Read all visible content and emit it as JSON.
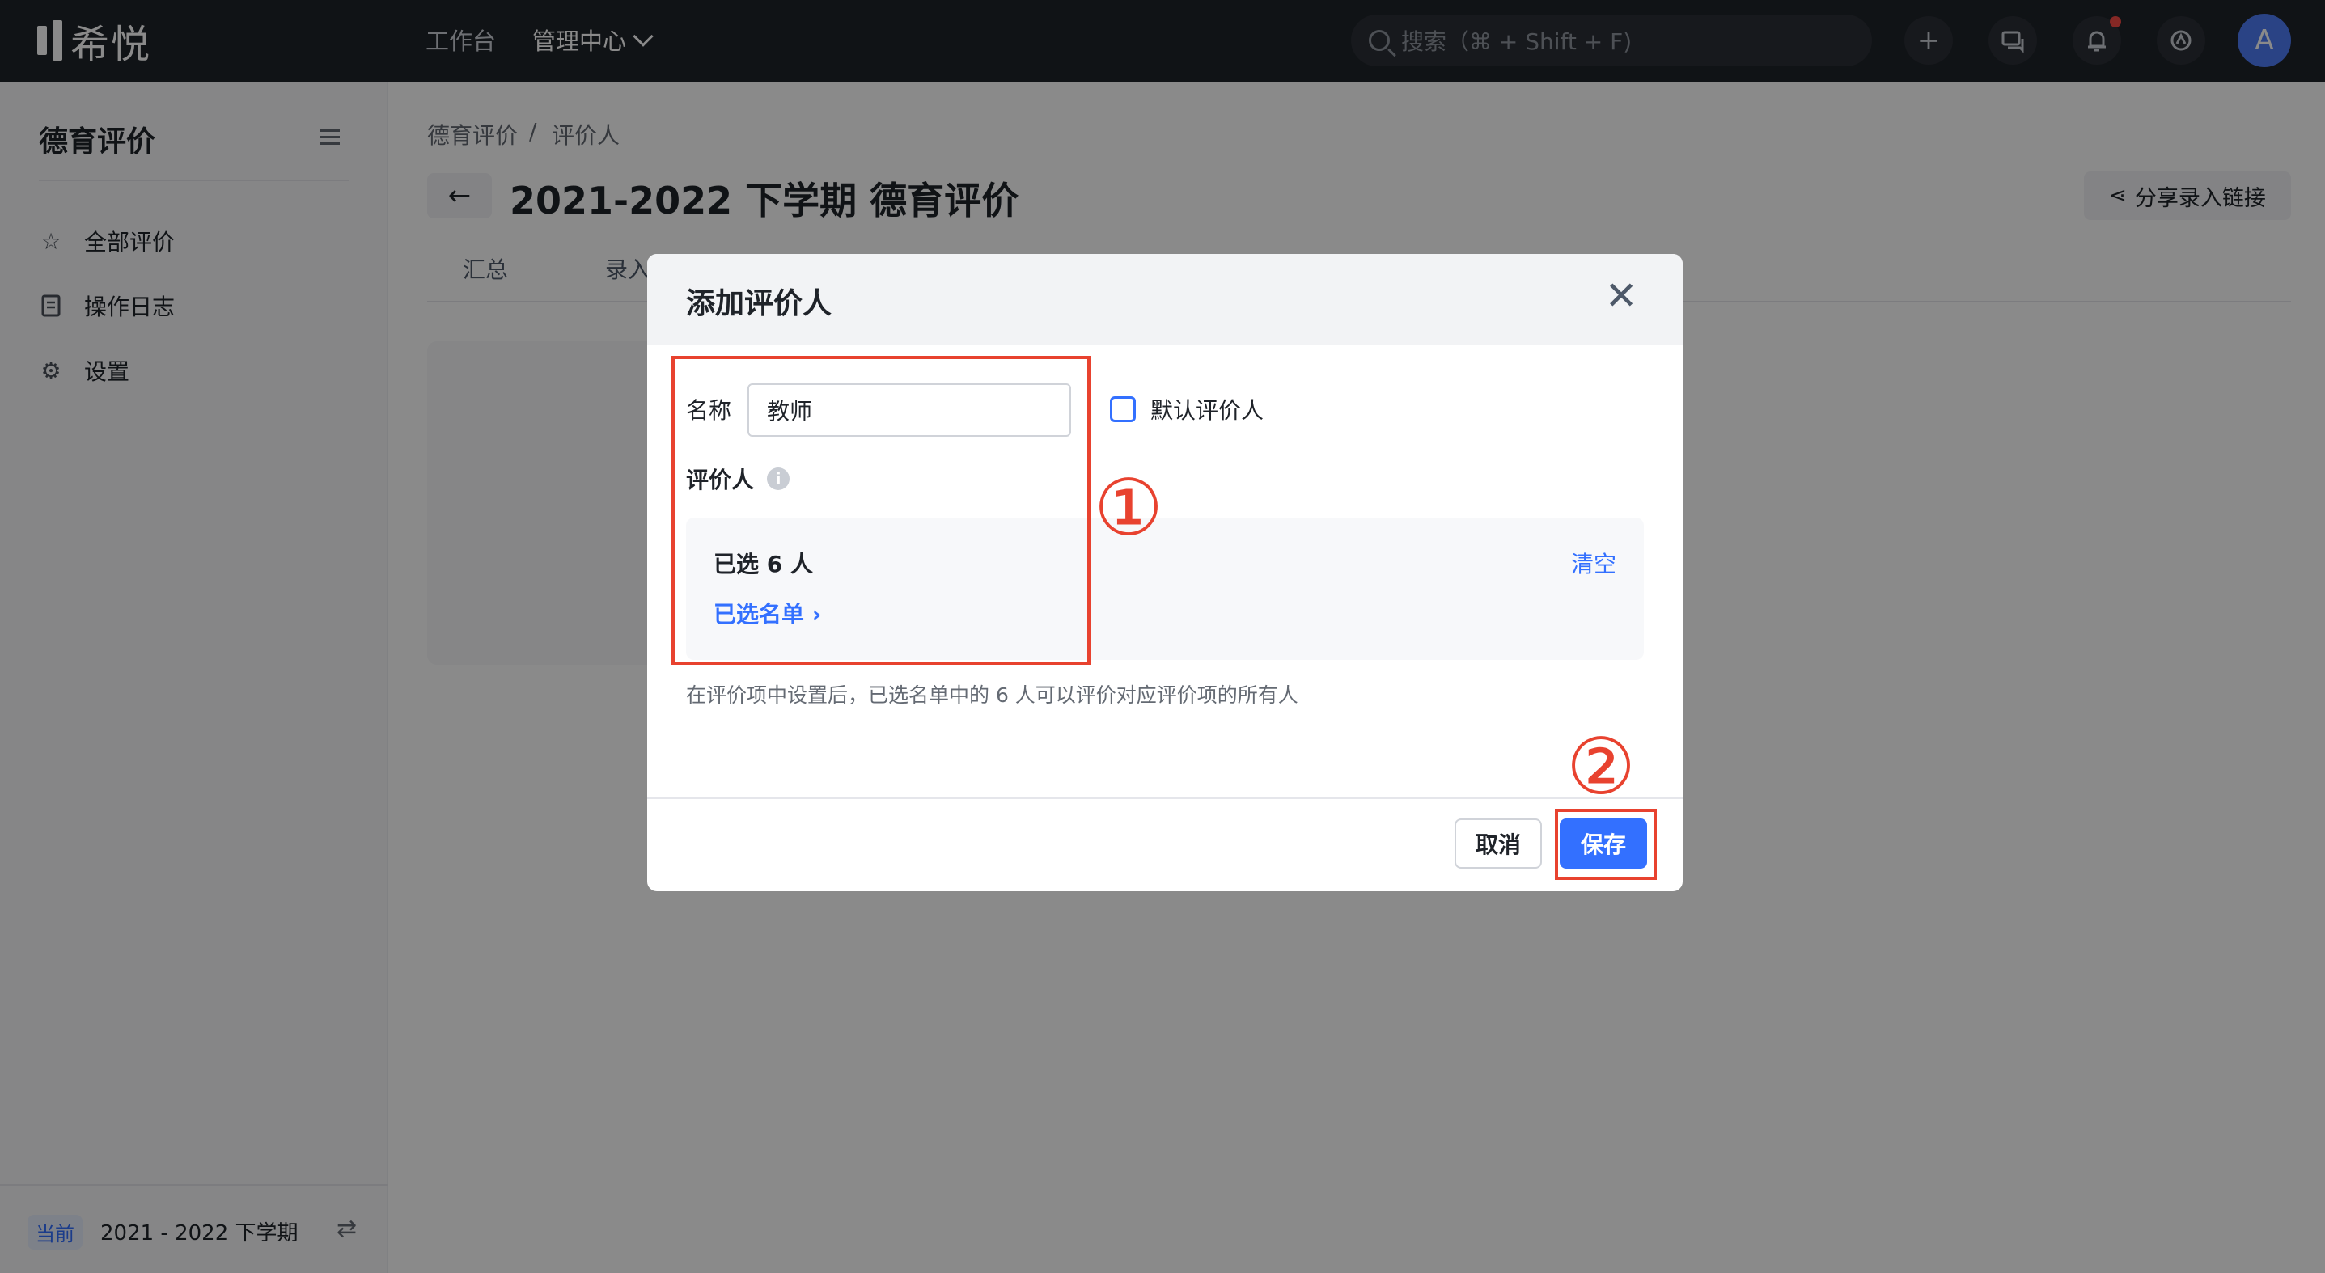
{
  "topbar": {
    "logo_text": "希悦",
    "nav_workbench": "工作台",
    "nav_admin": "管理中心",
    "search_placeholder": "搜索（⌘ + Shift + F)",
    "avatar_letter": "A",
    "plus_icon": "+",
    "accent": "#3370ff"
  },
  "sidebar": {
    "title": "德育评价",
    "items": [
      {
        "label": "全部评价",
        "icon": "star-icon"
      },
      {
        "label": "操作日志",
        "icon": "log-icon"
      },
      {
        "label": "设置",
        "icon": "gear-icon"
      }
    ],
    "current_badge": "当前",
    "current_term": "2021 - 2022 下学期"
  },
  "main": {
    "breadcrumb": [
      "德育评价",
      "/",
      "评价人"
    ],
    "title": "2021-2022 下学期 德育评价",
    "share_label": "分享录入链接",
    "tabs": [
      "汇总",
      "录入"
    ]
  },
  "modal": {
    "title": "添加评价人",
    "name_label": "名称",
    "name_value": "教师",
    "default_checkbox_label": "默认评价人",
    "evaluator_label": "评价人",
    "selected_count": "已选 6 人",
    "selected_list_link": "已选名单",
    "clear_link": "清空",
    "hint": "在评价项中设置后，已选名单中的 6 人可以评价对应评价项的所有人",
    "cancel_label": "取消",
    "save_label": "保存"
  },
  "annotations": {
    "step1": "①",
    "step2": "②",
    "color": "#e8422f"
  }
}
